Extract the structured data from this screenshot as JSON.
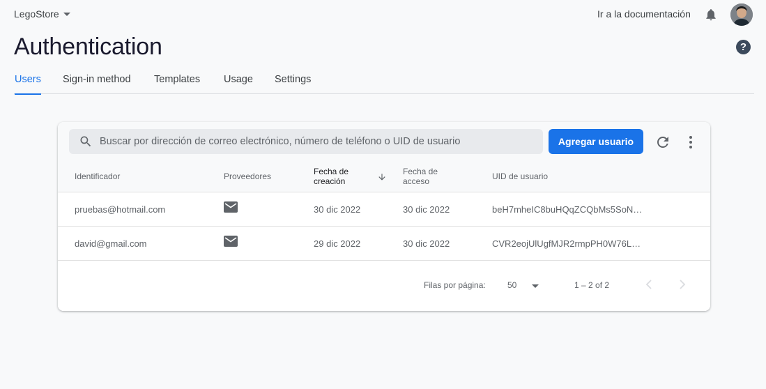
{
  "header": {
    "project": "LegoStore",
    "doc_link": "Ir a la documentación",
    "icons": {
      "bell": "notifications-icon",
      "help": "help-icon",
      "avatar": "user-avatar"
    }
  },
  "page": {
    "title": "Authentication",
    "help_glyph": "?"
  },
  "tabs": [
    {
      "label": "Users",
      "active": true
    },
    {
      "label": "Sign-in method",
      "active": false
    },
    {
      "label": "Templates",
      "active": false
    },
    {
      "label": "Usage",
      "active": false
    },
    {
      "label": "Settings",
      "active": false
    }
  ],
  "users_table": {
    "search_placeholder": "Buscar por dirección de correo electrónico, número de teléfono o UID de usuario",
    "add_button": "Agregar usuario",
    "columns": {
      "identifier": "Identificador",
      "providers": "Proveedores",
      "created_l1": "Fecha de",
      "created_l2": "creación",
      "access_l1": "Fecha de",
      "access_l2": "acceso",
      "uid": "UID de usuario"
    },
    "rows": [
      {
        "identifier": "pruebas@hotmail.com",
        "provider": "email-icon",
        "created": "30 dic 2022",
        "accessed": "30 dic 2022",
        "uid": "beH7mheIC8buHQqZCQbMs5SoN…"
      },
      {
        "identifier": "david@gmail.com",
        "provider": "email-icon",
        "created": "29 dic 2022",
        "accessed": "30 dic 2022",
        "uid": "CVR2eojUlUgfMJR2rmpPH0W76L…"
      }
    ],
    "footer": {
      "rows_per_page_label": "Filas por página:",
      "rows_per_page": "50",
      "range": "1 – 2 of 2"
    }
  },
  "colors": {
    "accent": "#1a73e8",
    "background": "#f8f9fa",
    "text": "#202124",
    "muted": "#5f6368"
  }
}
